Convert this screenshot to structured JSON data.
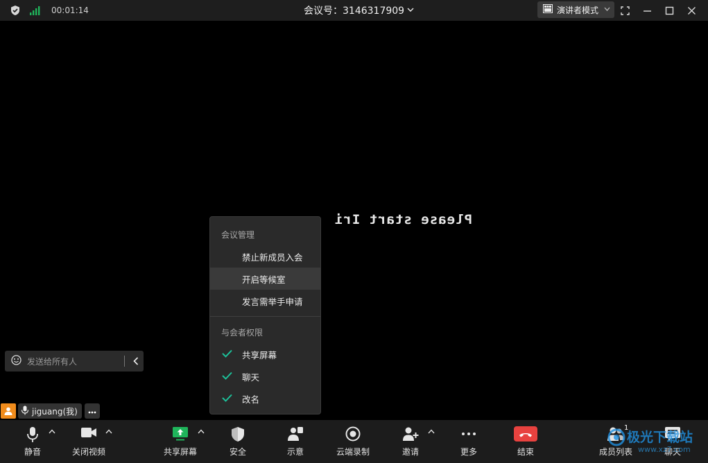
{
  "titlebar": {
    "timer": "00:01:14",
    "meeting_id": "会议号：3146317909",
    "view_mode": "演讲者模式"
  },
  "stage": {
    "shared_text": "Please start Iri"
  },
  "popup": {
    "section1_title": "会议管理",
    "section1_items": [
      "禁止新成员入会",
      "开启等候室",
      "发言需举手申请"
    ],
    "section2_title": "与会者权限",
    "section2_items": [
      "共享屏幕",
      "聊天",
      "改名"
    ]
  },
  "chat": {
    "placeholder": "发送给所有人"
  },
  "self": {
    "name": "jiguang(我)"
  },
  "toolbar": {
    "mute": "静音",
    "stop_video": "关闭视频",
    "share_screen": "共享屏幕",
    "security": "安全",
    "signal": "示意",
    "cloud_record": "云端录制",
    "invite": "邀请",
    "more": "更多",
    "end": "结束",
    "members": "成员列表",
    "members_count": "1",
    "chat": "聊天"
  },
  "colors": {
    "accent_green": "#1fb55b",
    "end_red": "#e8423f",
    "check_teal": "#1cc29a",
    "avatar_orange": "#f08c1c"
  },
  "watermark": {
    "main": "极光下载站",
    "sub": "www.xz7.com"
  }
}
